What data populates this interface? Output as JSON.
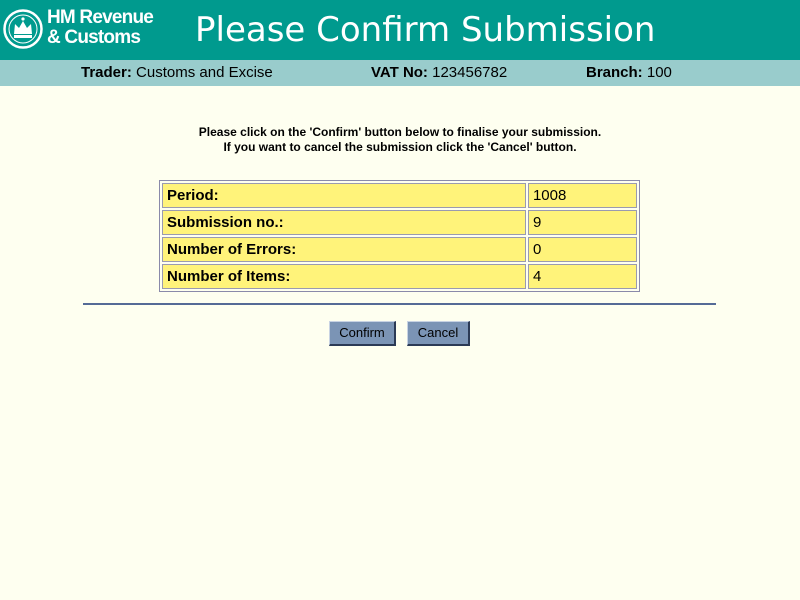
{
  "header": {
    "logo_line1": "HM Revenue",
    "logo_line2": "& Customs",
    "title": "Please Confirm Submission",
    "background_color": "#009a8e"
  },
  "infobar": {
    "trader_label": "Trader:",
    "trader_value": "Customs and Excise",
    "vat_label": "VAT No:",
    "vat_value": "123456782",
    "branch_label": "Branch:",
    "branch_value": "100",
    "background_color": "#99cccc"
  },
  "instructions": {
    "line1": "Please click on the 'Confirm' button below to finalise your submission.",
    "line2": "If you want to cancel the submission click the 'Cancel' button."
  },
  "summary": {
    "rows": [
      {
        "label": "Period:",
        "value": "1008"
      },
      {
        "label": "Submission no.:",
        "value": "9"
      },
      {
        "label": "Number of Errors:",
        "value": "0"
      },
      {
        "label": "Number of Items:",
        "value": "4"
      }
    ],
    "cell_color": "#fff37a"
  },
  "actions": {
    "confirm_label": "Confirm",
    "cancel_label": "Cancel"
  }
}
